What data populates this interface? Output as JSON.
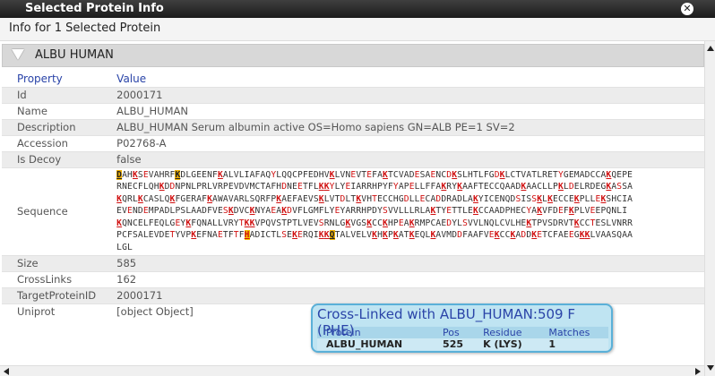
{
  "window": {
    "title": "Selected Protein Info",
    "subtitle": "Info for 1 Selected Protein"
  },
  "section": {
    "name": "ALBU HUMAN"
  },
  "columns": {
    "property": "Property",
    "value": "Value"
  },
  "rows": [
    {
      "property": "Id",
      "value": "2000171"
    },
    {
      "property": "Name",
      "value": "ALBU_HUMAN"
    },
    {
      "property": "Description",
      "value": "ALBU_HUMAN Serum albumin active OS=Homo sapiens GN=ALB PE=1 SV=2"
    },
    {
      "property": "Accession",
      "value": "P02768-A"
    },
    {
      "property": "Is Decoy",
      "value": "false"
    },
    {
      "property": "Sequence",
      "value": ""
    },
    {
      "property": "Size",
      "value": "585"
    },
    {
      "property": "CrossLinks",
      "value": "162"
    },
    {
      "property": "TargetProteinID",
      "value": "2000171"
    },
    {
      "property": "Uniprot",
      "value": "[object Object]"
    }
  ],
  "sequence_lines": [
    "DAHKSEVAHRFKDLGEENFKALVLIAFAQYLQQCPFEDHVKLVNEVTEFAKTCVADESAENCDKSLHTLFGDKLCTVATLRETYGEMADCCAKQEPE",
    "RNECFLQHKDDNPNLPRLVRPEVDVMCTAFHDNEETFLKKYLYEIARRHPYFYAPELLFFAKRYKAAFTECCQAADKAACLLPKLDELRDEGKASSA",
    "KQRLKCASLQKFGERAFKAWAVARLSQRFPKAEFAEVSKLVTDLTKVHTECCHGDLLECADDRADLAKYICENQDSISSKLKECCEKPLLEKSHCIA",
    "EVENDEMPADLPSLAADFVESKDVCKNYAEAKDVFLGMFLYEYARRHPDYSVVLLLRLAKTYETTLEKCCAADPHECYAKVFDEFKPLVEEPQNLI",
    "KQNCELFEQLGEYKFQNALLVRYTKKVPQVSTPTLVEVSRNLGKVGSKCCKHPEAKRMPCAEDYLSVVLNQLCVLHEKTPVSDRVTKCCTESLVNRR",
    "PCFSALEVDETYVPKEFNAETFTFHADICTLSEKERQIKKQTALVELVKHKPKATKEQLKAVMDDFAAFVEKCCKADDKETCFAEEGKKLVAASQAA",
    "LGL"
  ],
  "tooltip": {
    "title": "Cross-Linked with ALBU_HUMAN:509 F (PHE)",
    "headers": [
      "Protein",
      "Pos",
      "Residue",
      "Matches"
    ],
    "row": [
      "ALBU_HUMAN",
      "525",
      "K (LYS)",
      "1"
    ]
  },
  "colors": {
    "crosslink_residue": "#d01010",
    "highlight": "#f0b000",
    "header_link": "#2a44a8",
    "tooltip_bg": "#bfe4f2"
  },
  "icons": [
    "close-icon",
    "collapse-triangle-icon"
  ]
}
